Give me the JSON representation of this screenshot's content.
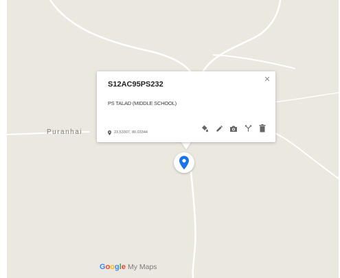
{
  "map": {
    "place_label": "Puranhai",
    "colors": {
      "land": "#ebe8e0",
      "road": "#ffffff",
      "marker": "#1a73e8"
    }
  },
  "popup": {
    "title": "S12AC95PS232",
    "description": "PS TALAD (MIDDLE SCHOOL)",
    "coordinates": "23.53307, 80.03344",
    "close_icon": "close-icon",
    "tools": [
      "style-icon",
      "edit-icon",
      "camera-icon",
      "directions-icon",
      "delete-icon"
    ]
  },
  "marker": {
    "icon": "location-pin-icon"
  },
  "attribution": {
    "brand_letters": [
      {
        "char": "G",
        "color": "#4285f4"
      },
      {
        "char": "o",
        "color": "#ea4335"
      },
      {
        "char": "o",
        "color": "#fbbc05"
      },
      {
        "char": "g",
        "color": "#4285f4"
      },
      {
        "char": "l",
        "color": "#34a853"
      },
      {
        "char": "e",
        "color": "#ea4335"
      }
    ],
    "product": "My Maps"
  }
}
